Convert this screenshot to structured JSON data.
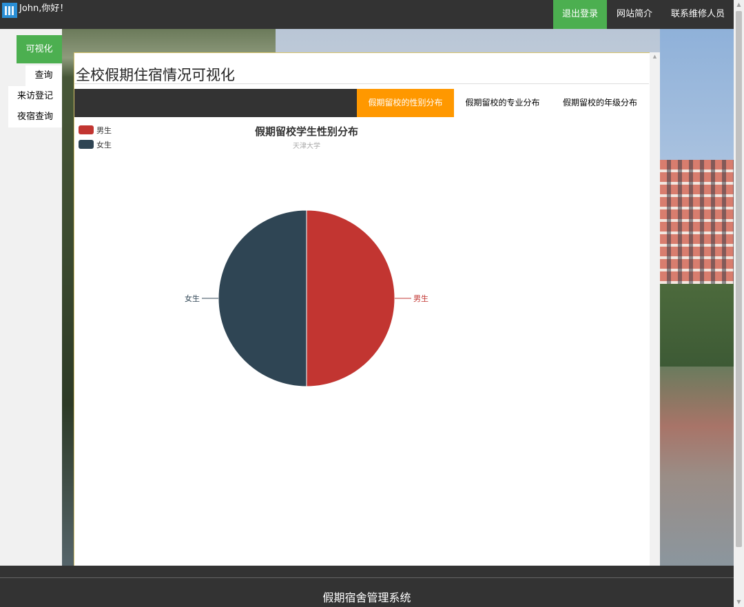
{
  "header": {
    "greeting": "John,你好！",
    "logout": "退出登录",
    "about": "网站简介",
    "contact_repair": "联系维修人员"
  },
  "sidebar": {
    "items": [
      {
        "label": "可视化",
        "active": true
      },
      {
        "label": "查询",
        "active": false
      },
      {
        "label": "来访登记",
        "active": false
      },
      {
        "label": "夜宿查询",
        "active": false
      }
    ]
  },
  "main": {
    "title": "全校假期住宿情况可视化",
    "tabs": [
      {
        "label": "假期留校的性别分布",
        "active": true
      },
      {
        "label": "假期留校的专业分布",
        "active": false
      },
      {
        "label": "假期留校的年级分布",
        "active": false
      }
    ]
  },
  "chart_data": {
    "type": "pie",
    "title": "假期留校学生性别分布",
    "subtitle": "天津大学",
    "legend_position": "top-left",
    "slices": [
      {
        "name": "男生",
        "value": 50,
        "color": "#c23531"
      },
      {
        "name": "女生",
        "value": 50,
        "color": "#2f4554"
      }
    ]
  },
  "footer": {
    "text": "假期宿舍管理系统"
  },
  "colors": {
    "accent_green": "#4caf50",
    "tab_active": "#ff9800",
    "nav_dark": "#333333"
  }
}
